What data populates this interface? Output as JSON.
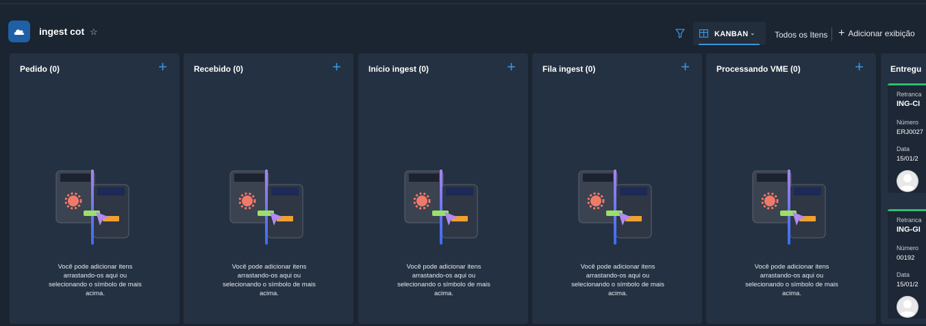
{
  "header": {
    "list_title": "ingest cot",
    "view_label": "KANBAN",
    "all_items_label": "Todos os Itens",
    "add_view_label": "Adicionar exibição"
  },
  "columns": [
    {
      "title": "Pedido (0)"
    },
    {
      "title": "Recebido (0)"
    },
    {
      "title": "Início ingest (0)"
    },
    {
      "title": "Fila ingest (0)"
    },
    {
      "title": "Processando VME (0)"
    }
  ],
  "empty_message": "Você pode adicionar itens arrastando-os aqui ou selecionando o símbolo de mais acima.",
  "partial_column": {
    "title": "Entregu",
    "cards": [
      {
        "field1_label": "Retranca",
        "title": "ING-CI",
        "field2_label": "Número",
        "field2_value": "ERJ0027",
        "field3_label": "Data",
        "field3_value": "15/01/2"
      },
      {
        "field1_label": "Retranca",
        "title": "ING-GI",
        "field2_label": "Número",
        "field2_value": "00192",
        "field3_label": "Data",
        "field3_value": "15/01/2"
      }
    ]
  },
  "colors": {
    "accent": "#3a96dd",
    "card_status": "#2fbf71",
    "column_bg": "#243142",
    "page_bg": "#1b2431"
  }
}
